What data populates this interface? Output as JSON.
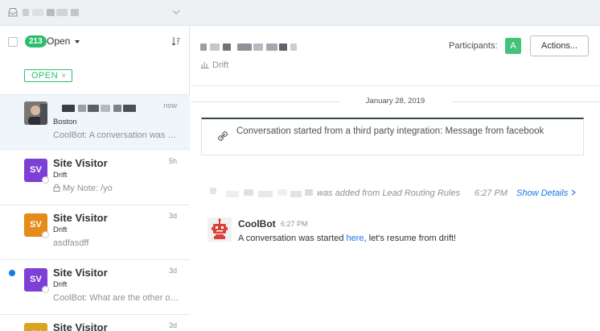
{
  "inbox": {
    "icon": "inbox-icon"
  },
  "colors": {
    "accent_green": "#2dbd6e",
    "link_blue": "#1679e8",
    "purple_avatar": "#7e3fd6",
    "orange_avatar": "#e68a1a"
  },
  "list_header": {
    "count": "213",
    "status": "Open"
  },
  "filter": {
    "chip_label": "OPEN",
    "chip_close": "×"
  },
  "conversations": [
    {
      "name": "",
      "sub": "Boston",
      "preview": "CoolBot: A conversation was started from a third party integration",
      "time": "now"
    },
    {
      "initials": "SV",
      "name": "Site Visitor",
      "sub": "Drift",
      "preview": "My Note: /yo",
      "time": "5h"
    },
    {
      "initials": "SV",
      "name": "Site Visitor",
      "sub": "Drift",
      "preview": "asdfasdff",
      "time": "3d"
    },
    {
      "initials": "SV",
      "name": "Site Visitor",
      "sub": "Drift",
      "preview": "CoolBot: What are the other options for you?",
      "time": "3d"
    },
    {
      "initials": "SV",
      "name": "Site Visitor",
      "sub": "",
      "preview": "",
      "time": "3d"
    }
  ],
  "main": {
    "source": "Drift",
    "participants_label": "Participants:",
    "participant_initial": "A",
    "actions_label": "Actions..."
  },
  "timeline": {
    "date": "January 28, 2019",
    "started_text": "Conversation started from a third party integration: Message from facebook",
    "routing_text": "was added from Lead Routing Rules",
    "routing_time": "6:27 PM",
    "show_details": "Show Details"
  },
  "message": {
    "author": "CoolBot",
    "time": "6:27 PM",
    "text_before": "A conversation was started ",
    "link_text": "here",
    "text_after": ", let's resume from drift!"
  }
}
